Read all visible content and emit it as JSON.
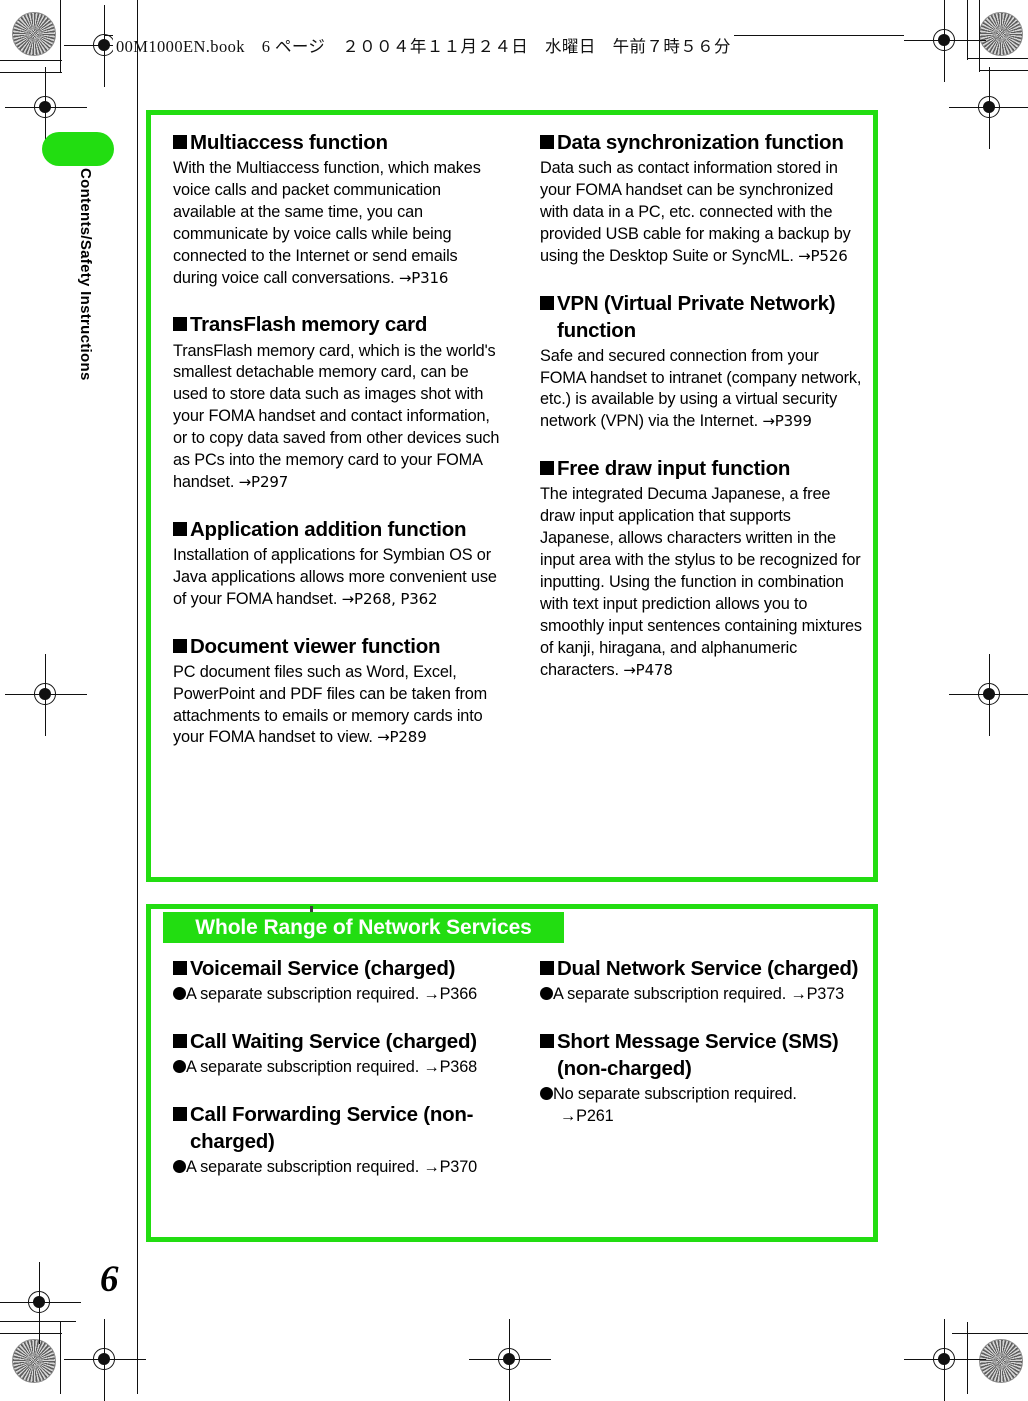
{
  "page": {
    "header_text": "00M1000EN.book　6 ページ　２００４年１１月２４日　水曜日　午前７時５６分",
    "page_number": "6",
    "side_tab_label": "Contents/Safety Instructions",
    "accent_green": "#22dd11",
    "banner_text_color": "#ffffff"
  },
  "features_panel": {
    "left_column": [
      {
        "title": "Multiaccess function",
        "body": "With the Multiaccess function, which makes voice calls and packet communication available at the same time, you can communicate by voice calls while being connected to the Internet or send emails during voice call conversations. ",
        "ref": "→P316"
      },
      {
        "title": "TransFlash memory card",
        "body": "TransFlash memory card, which is the world's smallest detachable memory card, can be used to store data such as images shot with your FOMA handset and contact information, or to copy data saved from other devices such as PCs into the memory card to your FOMA handset. ",
        "ref": "→P297"
      },
      {
        "title": "Application addition function",
        "body": "Installation of applications for Symbian OS or Java applications allows more convenient use of your FOMA handset. ",
        "ref": "→P268, P362"
      },
      {
        "title": "Document viewer function",
        "body": "PC document files such as Word, Excel, PowerPoint and PDF files can be taken from attachments to emails or memory cards into your FOMA handset to view. ",
        "ref": "→P289"
      }
    ],
    "right_column": [
      {
        "title": "Data synchronization function",
        "body": "Data such as contact information stored in your FOMA handset can be synchronized with data in a PC, etc. connected with the provided USB cable for making a backup by using the Desktop Suite or SyncML. ",
        "ref": "→P526"
      },
      {
        "title": "VPN (Virtual Private Network) function",
        "body": "Safe and secured connection from your FOMA handset to intranet (company network, etc.) is available by using a virtual security network (VPN) via the Internet. ",
        "ref": "→P399"
      },
      {
        "title": "Free draw input function",
        "body": "The integrated Decuma Japanese, a free draw input application that supports Japanese, allows characters written in the input area with the stylus to be recognized for inputting. Using the function in combination with text input prediction allows you to smoothly input sentences containing mixtures of kanji, hiragana, and alphanumeric characters. ",
        "ref": "→P478"
      }
    ]
  },
  "network_panel": {
    "banner_title": "Whole Range of Network Services",
    "left_column": [
      {
        "title": "Voicemail Service (charged)",
        "note": "A separate subscription required. ",
        "ref": "→P366"
      },
      {
        "title": "Call Waiting Service (charged)",
        "note": "A separate subscription required. ",
        "ref": "→P368"
      },
      {
        "title": "Call Forwarding Service (non-charged)",
        "note": "A separate subscription required. ",
        "ref": "→P370"
      }
    ],
    "right_column": [
      {
        "title": "Dual Network Service (charged)",
        "note": "A separate subscription required. ",
        "ref": "→P373"
      },
      {
        "title": "Short Message Service (SMS) (non-charged)",
        "note": "No separate subscription required.",
        "ref": "→P261"
      }
    ]
  }
}
